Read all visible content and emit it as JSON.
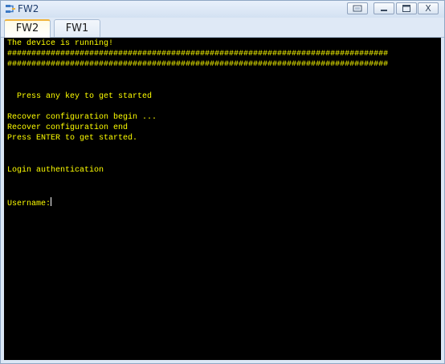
{
  "window": {
    "title": "FW2",
    "buttons": {
      "restore_icon": "restore-icon",
      "minimize_icon": "minimize-icon",
      "maximize_icon": "maximize-icon",
      "close_label": "X"
    }
  },
  "tabs": [
    {
      "label": "FW2",
      "active": true
    },
    {
      "label": "FW1",
      "active": false
    }
  ],
  "terminal": {
    "text_color": "#ffff00",
    "background": "#000000",
    "lines": [
      "The device is running!",
      "###############################################################################",
      "###############################################################################",
      "",
      "",
      "  Press any key to get started",
      "",
      "Recover configuration begin ...",
      "Recover configuration end",
      "Press ENTER to get started.",
      "",
      "",
      "",
      "Login authentication",
      "",
      "",
      "",
      "Username:"
    ]
  }
}
